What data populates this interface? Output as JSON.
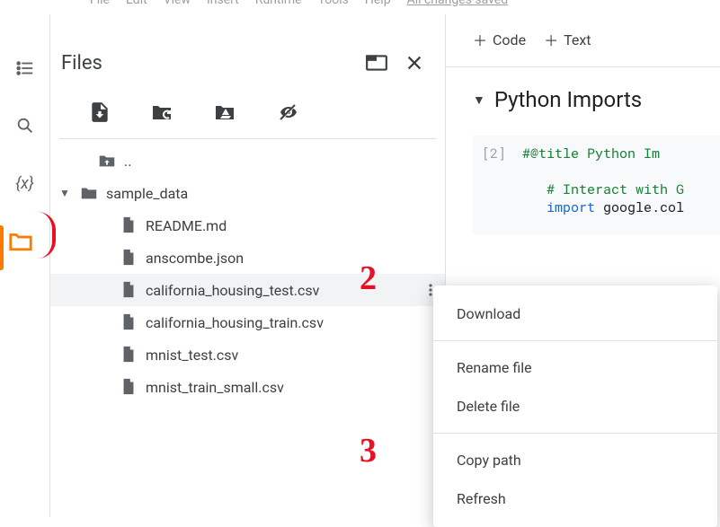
{
  "menu": {
    "items": [
      "File",
      "Edit",
      "View",
      "Insert",
      "Runtime",
      "Tools",
      "Help"
    ],
    "saved": "All changes saved"
  },
  "sidebarPanel": {
    "title": "Files",
    "tree": {
      "up": "..",
      "folder": "sample_data",
      "files": [
        "README.md",
        "anscombe.json",
        "california_housing_test.csv",
        "california_housing_train.csv",
        "mnist_test.csv",
        "mnist_train_small.csv"
      ]
    }
  },
  "notebook": {
    "toolbar": {
      "code": "Code",
      "text": "Text"
    },
    "section_title": "Python Imports",
    "cell": {
      "exec": "[2]",
      "line1": "#@title Python Im",
      "line2": "# Interact with G",
      "line3_kw": "import",
      "line3_rest": " google.col"
    }
  },
  "contextMenu": {
    "items": [
      "Download",
      "Rename file",
      "Delete file",
      "Copy path",
      "Refresh"
    ]
  },
  "annotations": {
    "two": "2",
    "three": "3"
  }
}
